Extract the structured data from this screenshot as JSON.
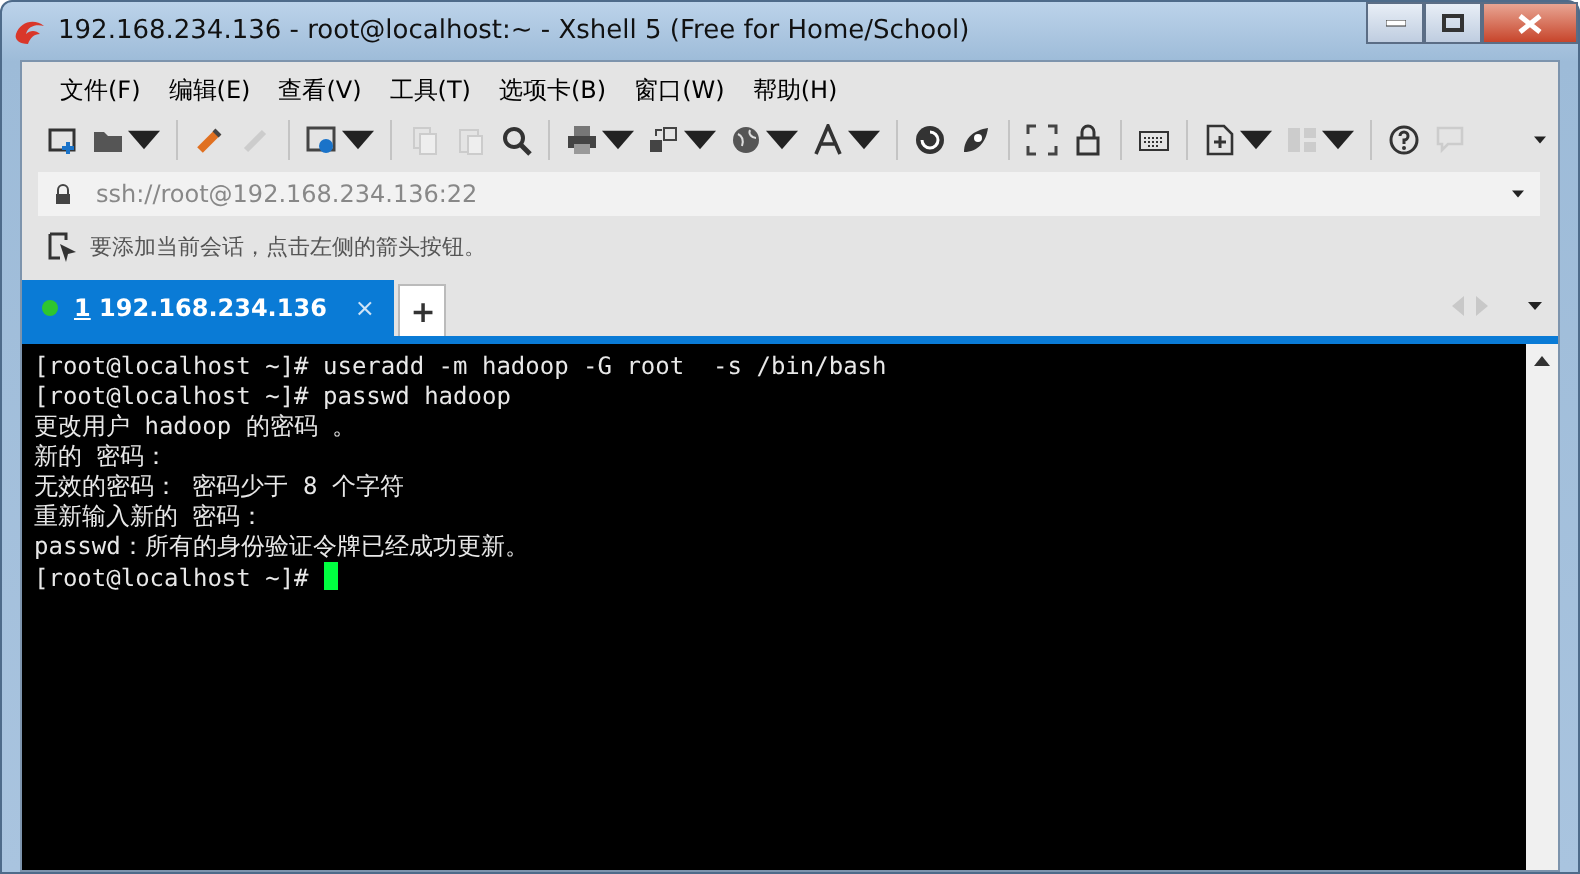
{
  "window": {
    "title": "192.168.234.136 - root@localhost:~ - Xshell 5 (Free for Home/School)"
  },
  "menu": [
    {
      "label": "文件(F)"
    },
    {
      "label": "编辑(E)"
    },
    {
      "label": "查看(V)"
    },
    {
      "label": "工具(T)"
    },
    {
      "label": "选项卡(B)"
    },
    {
      "label": "窗口(W)"
    },
    {
      "label": "帮助(H)"
    }
  ],
  "address": {
    "value": "ssh://root@192.168.234.136:22"
  },
  "hint": "要添加当前会话，点击左侧的箭头按钮。",
  "tabs": [
    {
      "number": "1",
      "label": "192.168.234.136",
      "selected": true,
      "connected": true,
      "close": "×"
    }
  ],
  "new_tab": "+",
  "terminal": {
    "lines": [
      "[root@localhost ~]# useradd -m hadoop -G root  -s /bin/bash",
      "[root@localhost ~]# passwd hadoop",
      "更改用户 hadoop 的密码 。",
      "新的 密码：",
      "无效的密码： 密码少于 8 个字符",
      "重新输入新的 密码：",
      "passwd：所有的身份验证令牌已经成功更新。",
      "[root@localhost ~]# "
    ],
    "cursor": true
  }
}
